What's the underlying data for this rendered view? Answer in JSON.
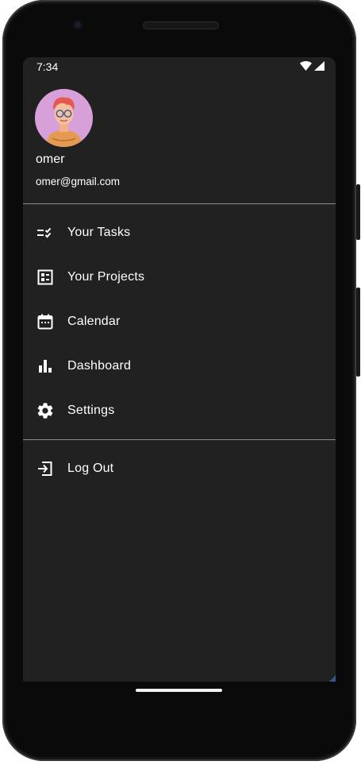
{
  "status_bar": {
    "time": "7:34",
    "icons": [
      "wifi-icon",
      "cell-signal-icon"
    ]
  },
  "drawer_header": {
    "user_name": "omer",
    "user_email": "omer@gmail.com",
    "avatar_bg": "#d8a0d8"
  },
  "menu": {
    "items": [
      {
        "label": "Your Tasks",
        "icon": "task-checklist-icon"
      },
      {
        "label": "Your Projects",
        "icon": "projects-list-icon"
      },
      {
        "label": "Calendar",
        "icon": "calendar-icon"
      },
      {
        "label": "Dashboard",
        "icon": "bar-chart-icon"
      },
      {
        "label": "Settings",
        "icon": "gear-icon"
      }
    ],
    "logout": {
      "label": "Log Out",
      "icon": "logout-icon"
    }
  },
  "colors": {
    "drawer_bg": "#212121",
    "text": "#ffffff",
    "divider": "#8c8c8c"
  }
}
